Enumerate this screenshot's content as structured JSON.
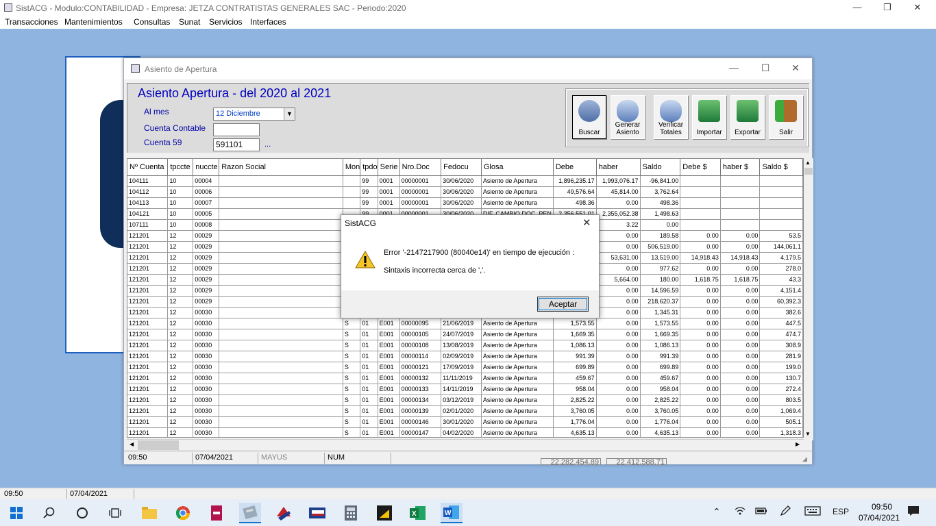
{
  "app": {
    "title": "SistACG - Modulo:CONTABILIDAD - Empresa: JETZA CONTRATISTAS GENERALES SAC - Periodo:2020",
    "window_buttons": [
      "—",
      "❐",
      "✕"
    ],
    "menu": [
      "Transacciones",
      "Mantenimientos",
      "Consultas",
      "Sunat",
      "Servicios",
      "Interfaces"
    ]
  },
  "child_window": {
    "title": "Asiento de Apertura",
    "heading": "Asiento Apertura - del 2020 al  2021",
    "labels": {
      "mes": "Al mes",
      "cuenta": "Cuenta Contable",
      "cuenta59": "Cuenta 59"
    },
    "mes_value": "12 Diciembre",
    "cuenta_value": "",
    "cuenta59_value": "591101",
    "ellipsis": "...",
    "toolbar": [
      {
        "label1": "",
        "label2": "Buscar",
        "icon": "binoculars-database-icon"
      },
      {
        "label1": "Generar",
        "label2": "Asiento",
        "icon": "database-generate-icon"
      },
      {
        "label1": "Verificar",
        "label2": "Totales",
        "icon": "database-verify-icon"
      },
      {
        "label1": "",
        "label2": "Importar",
        "icon": "excel-import-icon"
      },
      {
        "label1": "",
        "label2": "Exportar",
        "icon": "excel-export-icon"
      },
      {
        "label1": "",
        "label2": "Salir",
        "icon": "exit-door-icon"
      }
    ],
    "grid": {
      "columns": [
        "Nº Cuenta",
        "tpccte",
        "nuccte",
        "Razon Social",
        "Mon",
        "tpdo",
        "Serie",
        "Nro.Doc",
        "Fedocu",
        "Glosa",
        "Debe",
        "haber",
        "Saldo",
        "Debe $",
        "haber $",
        "Saldo $"
      ],
      "rows": [
        [
          "104111",
          "10",
          "00004",
          "",
          "",
          "99",
          "0001",
          "00000001",
          "30/06/2020",
          "Asiento de Apertura",
          "1,896,235.17",
          "1,993,076.17",
          "-96,841.00",
          "",
          "",
          ""
        ],
        [
          "104112",
          "10",
          "00006",
          "",
          "",
          "99",
          "0001",
          "00000001",
          "30/06/2020",
          "Asiento de Apertura",
          "49,576.64",
          "45,814.00",
          "3,762.64",
          "",
          "",
          ""
        ],
        [
          "104113",
          "10",
          "00007",
          "",
          "",
          "99",
          "0001",
          "00000001",
          "30/06/2020",
          "Asiento de Apertura",
          "498.36",
          "0.00",
          "498.36",
          "",
          "",
          ""
        ],
        [
          "104121",
          "10",
          "00005",
          "",
          "",
          "99",
          "0001",
          "00000001",
          "30/06/2020",
          "DIF. CAMBIO DOC. PEN",
          "2,356,551.01",
          "2,355,052.38",
          "1,498.63",
          "",
          "",
          ""
        ],
        [
          "107111",
          "10",
          "00008",
          "",
          "",
          "",
          "",
          "",
          "",
          "",
          "",
          "3.22",
          "0.00",
          "",
          "",
          ""
        ],
        [
          "121201",
          "12",
          "00029",
          "",
          "",
          "",
          "",
          "",
          "",
          "",
          "",
          "0.00",
          "189.58",
          "0.00",
          "0.00",
          "53.5"
        ],
        [
          "121201",
          "12",
          "00029",
          "",
          "",
          "",
          "",
          "",
          "",
          "",
          "",
          "0.00",
          "506,519.00",
          "0.00",
          "0.00",
          "144,061.1"
        ],
        [
          "121201",
          "12",
          "00029",
          "",
          "",
          "",
          "",
          "",
          "",
          "",
          "",
          "53,631.00",
          "13,519.00",
          "14,918.43",
          "14,918.43",
          "4,179.5"
        ],
        [
          "121201",
          "12",
          "00029",
          "",
          "",
          "",
          "",
          "",
          "",
          "",
          "",
          "0.00",
          "977.62",
          "0.00",
          "0.00",
          "278.0"
        ],
        [
          "121201",
          "12",
          "00029",
          "",
          "",
          "",
          "",
          "",
          "",
          "",
          "",
          "5,664.00",
          "180.00",
          "1,618.75",
          "1,618.75",
          "43.3"
        ],
        [
          "121201",
          "12",
          "00029",
          "",
          "",
          "",
          "",
          "",
          "",
          "",
          "",
          "0.00",
          "14,596.59",
          "0.00",
          "0.00",
          "4,151.4"
        ],
        [
          "121201",
          "12",
          "00029",
          "",
          "",
          "",
          "",
          "",
          "",
          "",
          "",
          "0.00",
          "218,620.37",
          "0.00",
          "0.00",
          "60,392.3"
        ],
        [
          "121201",
          "12",
          "00030",
          "",
          "",
          "",
          "",
          "",
          "",
          "",
          "",
          "0.00",
          "1,345.31",
          "0.00",
          "0.00",
          "382.6"
        ],
        [
          "121201",
          "12",
          "00030",
          "",
          "S",
          "01",
          "E001",
          "00000095",
          "21/06/2019",
          "Asiento de Apertura",
          "1,573.55",
          "0.00",
          "1,573.55",
          "0.00",
          "0.00",
          "447.5"
        ],
        [
          "121201",
          "12",
          "00030",
          "",
          "S",
          "01",
          "E001",
          "00000105",
          "24/07/2019",
          "Asiento de Apertura",
          "1,669.35",
          "0.00",
          "1,669.35",
          "0.00",
          "0.00",
          "474.7"
        ],
        [
          "121201",
          "12",
          "00030",
          "",
          "S",
          "01",
          "E001",
          "00000108",
          "13/08/2019",
          "Asiento de Apertura",
          "1,086.13",
          "0.00",
          "1,086.13",
          "0.00",
          "0.00",
          "308.9"
        ],
        [
          "121201",
          "12",
          "00030",
          "",
          "S",
          "01",
          "E001",
          "00000114",
          "02/09/2019",
          "Asiento de Apertura",
          "991.39",
          "0.00",
          "991.39",
          "0.00",
          "0.00",
          "281.9"
        ],
        [
          "121201",
          "12",
          "00030",
          "",
          "S",
          "01",
          "E001",
          "00000121",
          "17/09/2019",
          "Asiento de Apertura",
          "699.89",
          "0.00",
          "699.89",
          "0.00",
          "0.00",
          "199.0"
        ],
        [
          "121201",
          "12",
          "00030",
          "",
          "S",
          "01",
          "E001",
          "00000132",
          "11/11/2019",
          "Asiento de Apertura",
          "459.67",
          "0.00",
          "459.67",
          "0.00",
          "0.00",
          "130.7"
        ],
        [
          "121201",
          "12",
          "00030",
          "",
          "S",
          "01",
          "E001",
          "00000133",
          "14/11/2019",
          "Asiento de Apertura",
          "958.04",
          "0.00",
          "958.04",
          "0.00",
          "0.00",
          "272.4"
        ],
        [
          "121201",
          "12",
          "00030",
          "",
          "S",
          "01",
          "E001",
          "00000134",
          "03/12/2019",
          "Asiento de Apertura",
          "2,825.22",
          "0.00",
          "2,825.22",
          "0.00",
          "0.00",
          "803.5"
        ],
        [
          "121201",
          "12",
          "00030",
          "",
          "S",
          "01",
          "E001",
          "00000139",
          "02/01/2020",
          "Asiento de Apertura",
          "3,760.05",
          "0.00",
          "3,760.05",
          "0.00",
          "0.00",
          "1,069.4"
        ],
        [
          "121201",
          "12",
          "00030",
          "",
          "S",
          "01",
          "E001",
          "00000146",
          "30/01/2020",
          "Asiento de Apertura",
          "1,776.04",
          "0.00",
          "1,776.04",
          "0.00",
          "0.00",
          "505.1"
        ],
        [
          "121201",
          "12",
          "00030",
          "",
          "S",
          "01",
          "E001",
          "00000147",
          "04/02/2020",
          "Asiento de Apertura",
          "4,635.13",
          "0.00",
          "4,635.13",
          "0.00",
          "0.00",
          "1,318.3"
        ]
      ]
    },
    "status": {
      "time": "09:50",
      "date": "07/04/2021",
      "caps": "MAYUS",
      "num": "NUM",
      "total1": "22,282,454.89",
      "total2": "22,412,588.71"
    }
  },
  "dialog": {
    "title": "SistACG",
    "close": "✕",
    "message1": "Error '-2147217900 (80040e14)' en tiempo de ejecución :",
    "message2": "Sintaxis incorrecta cerca de ','.",
    "ok": "Aceptar",
    "icon": "warning-icon"
  },
  "main_status": {
    "time": "09:50",
    "date": "07/04/2021"
  },
  "taskbar": {
    "icons": [
      "windows-start-icon",
      "search-icon",
      "cortana-icon",
      "task-view-icon",
      "file-explorer-icon",
      "chrome-icon",
      "app-icon-1",
      "sistacg-icon",
      "app-icon-2",
      "app-icon-3",
      "calculator-icon",
      "app-icon-4",
      "excel-icon",
      "word-icon"
    ],
    "lang": "ESP",
    "time": "09:50",
    "date": "07/04/2021"
  }
}
